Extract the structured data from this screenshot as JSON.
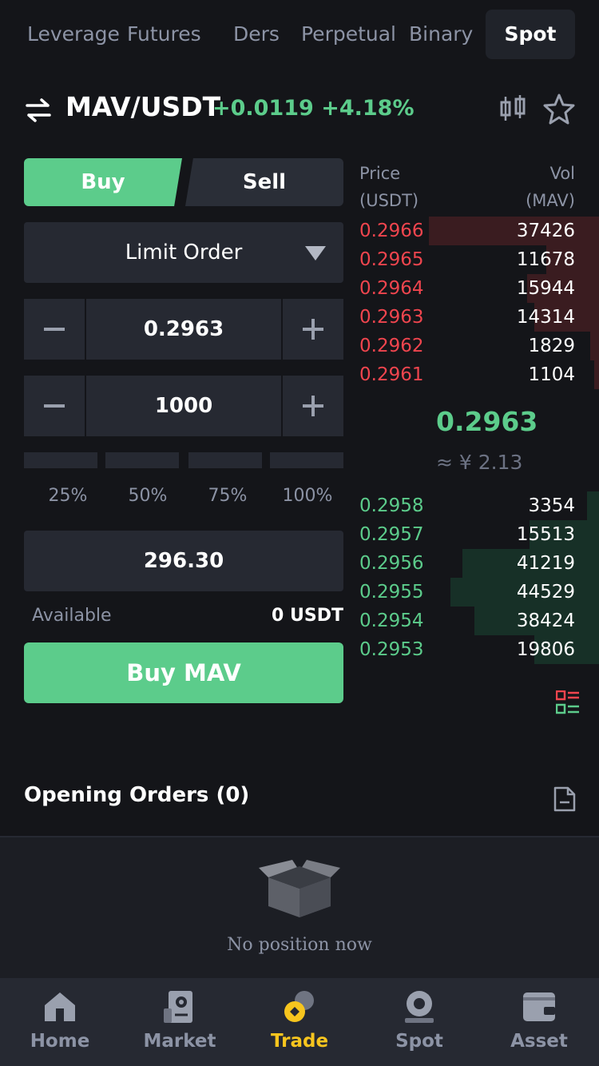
{
  "top_tabs": [
    {
      "label": "Leverage"
    },
    {
      "label": "Futures"
    },
    {
      "label": "Ders"
    },
    {
      "label": "Perpetual"
    },
    {
      "label": "Binary"
    },
    {
      "label": "Spot",
      "active": true
    }
  ],
  "pair": {
    "name": "MAV/USDT",
    "change": "+0.0119 +4.18%"
  },
  "trade_form": {
    "buy_tab": "Buy",
    "sell_tab": "Sell",
    "order_type": "Limit Order",
    "price_value": "0.2963",
    "amount_value": "1000",
    "percent_options": [
      "25%",
      "50%",
      "75%",
      "100%"
    ],
    "total_value": "296.30",
    "available_label": "Available",
    "available_value": "0 USDT",
    "submit_label": "Buy MAV"
  },
  "order_book": {
    "price_header_line1": "Price",
    "price_header_line2": "(USDT)",
    "vol_header_line1": "Vol",
    "vol_header_line2": "(MAV)",
    "asks": [
      {
        "price": "0.2966",
        "vol": "37426",
        "depth": 0.71
      },
      {
        "price": "0.2965",
        "vol": "11678",
        "depth": 0.22
      },
      {
        "price": "0.2964",
        "vol": "15944",
        "depth": 0.3
      },
      {
        "price": "0.2963",
        "vol": "14314",
        "depth": 0.27
      },
      {
        "price": "0.2962",
        "vol": "1829",
        "depth": 0.035
      },
      {
        "price": "0.2961",
        "vol": "1104",
        "depth": 0.02
      }
    ],
    "last_price": "0.2963",
    "approx_cny": "≈ ¥  2.13",
    "bids": [
      {
        "price": "0.2958",
        "vol": "3354",
        "depth": 0.05
      },
      {
        "price": "0.2957",
        "vol": "15513",
        "depth": 0.29
      },
      {
        "price": "0.2956",
        "vol": "41219",
        "depth": 0.57
      },
      {
        "price": "0.2955",
        "vol": "44529",
        "depth": 0.62
      },
      {
        "price": "0.2954",
        "vol": "38424",
        "depth": 0.52
      },
      {
        "price": "0.2953",
        "vol": "19806",
        "depth": 0.27
      }
    ]
  },
  "orders": {
    "title": "Opening Orders (0)",
    "empty_text": "No position now"
  },
  "bottom_nav": [
    {
      "label": "Home",
      "icon": "home-icon"
    },
    {
      "label": "Market",
      "icon": "market-icon"
    },
    {
      "label": "Trade",
      "icon": "trade-icon",
      "active": true
    },
    {
      "label": "Spot",
      "icon": "spot-icon"
    },
    {
      "label": "Asset",
      "icon": "wallet-icon"
    }
  ],
  "colors": {
    "background": "#141519",
    "panel": "#262932",
    "buy_green": "#5ccc8b",
    "sell_red": "#f0454e",
    "active_nav": "#f7c51e"
  }
}
